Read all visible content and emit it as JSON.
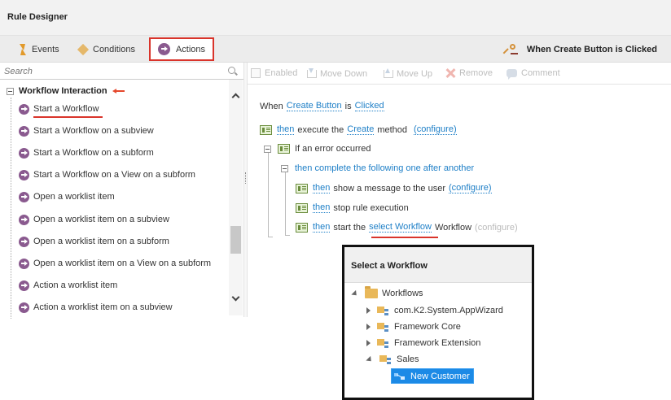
{
  "window": {
    "title": "Rule Designer"
  },
  "tabs": [
    {
      "label": "Events",
      "icon": "lightning-icon"
    },
    {
      "label": "Conditions",
      "icon": "diamond-icon"
    },
    {
      "label": "Actions",
      "icon": "arrow-circle-icon",
      "selected": true
    }
  ],
  "rule_header": {
    "title": "When Create Button is Clicked",
    "icon": "key-icon"
  },
  "search": {
    "placeholder": "Search"
  },
  "action_group": {
    "label": "Workflow Interaction",
    "items": [
      "Start a Workflow",
      "Start a Workflow on a subview",
      "Start a Workflow on a subform",
      "Start a Workflow on a View on a subform",
      "Open a worklist item",
      "Open a worklist item on a subview",
      "Open a worklist item on a subform",
      "Open a worklist item on a View on a subform",
      "Action a worklist item",
      "Action a worklist item on a subview"
    ]
  },
  "toolbar": {
    "enabled": "Enabled",
    "move_down": "Move Down",
    "move_up": "Move Up",
    "remove": "Remove",
    "comment": "Comment"
  },
  "rule": {
    "when": "When",
    "control": "Create Button",
    "is": "is",
    "event": "Clicked",
    "line1": {
      "then": "then",
      "text1": "execute the",
      "method": "Create",
      "text2": "method",
      "configure": "(configure)"
    },
    "line2": {
      "text": "If an error occurred"
    },
    "line3": {
      "text": "then complete the following one after another"
    },
    "line4": {
      "then": "then",
      "text": "show a message to the user",
      "configure": "(configure)"
    },
    "line5": {
      "then": "then",
      "text": "stop rule execution"
    },
    "line6": {
      "then": "then",
      "text1": "start the",
      "workflow_link": "select Workflow",
      "text2": "Workflow",
      "configure": "(configure)"
    }
  },
  "popup": {
    "title": "Select a Workflow",
    "root": "Workflows",
    "children": [
      "com.K2.System.AppWizard",
      "Framework Core",
      "Framework Extension",
      "Sales"
    ],
    "selected": "New Customer"
  },
  "colors": {
    "accent_red": "#d9342b",
    "link_blue": "#1e7fc7",
    "selection_blue": "#1c8ae6"
  }
}
